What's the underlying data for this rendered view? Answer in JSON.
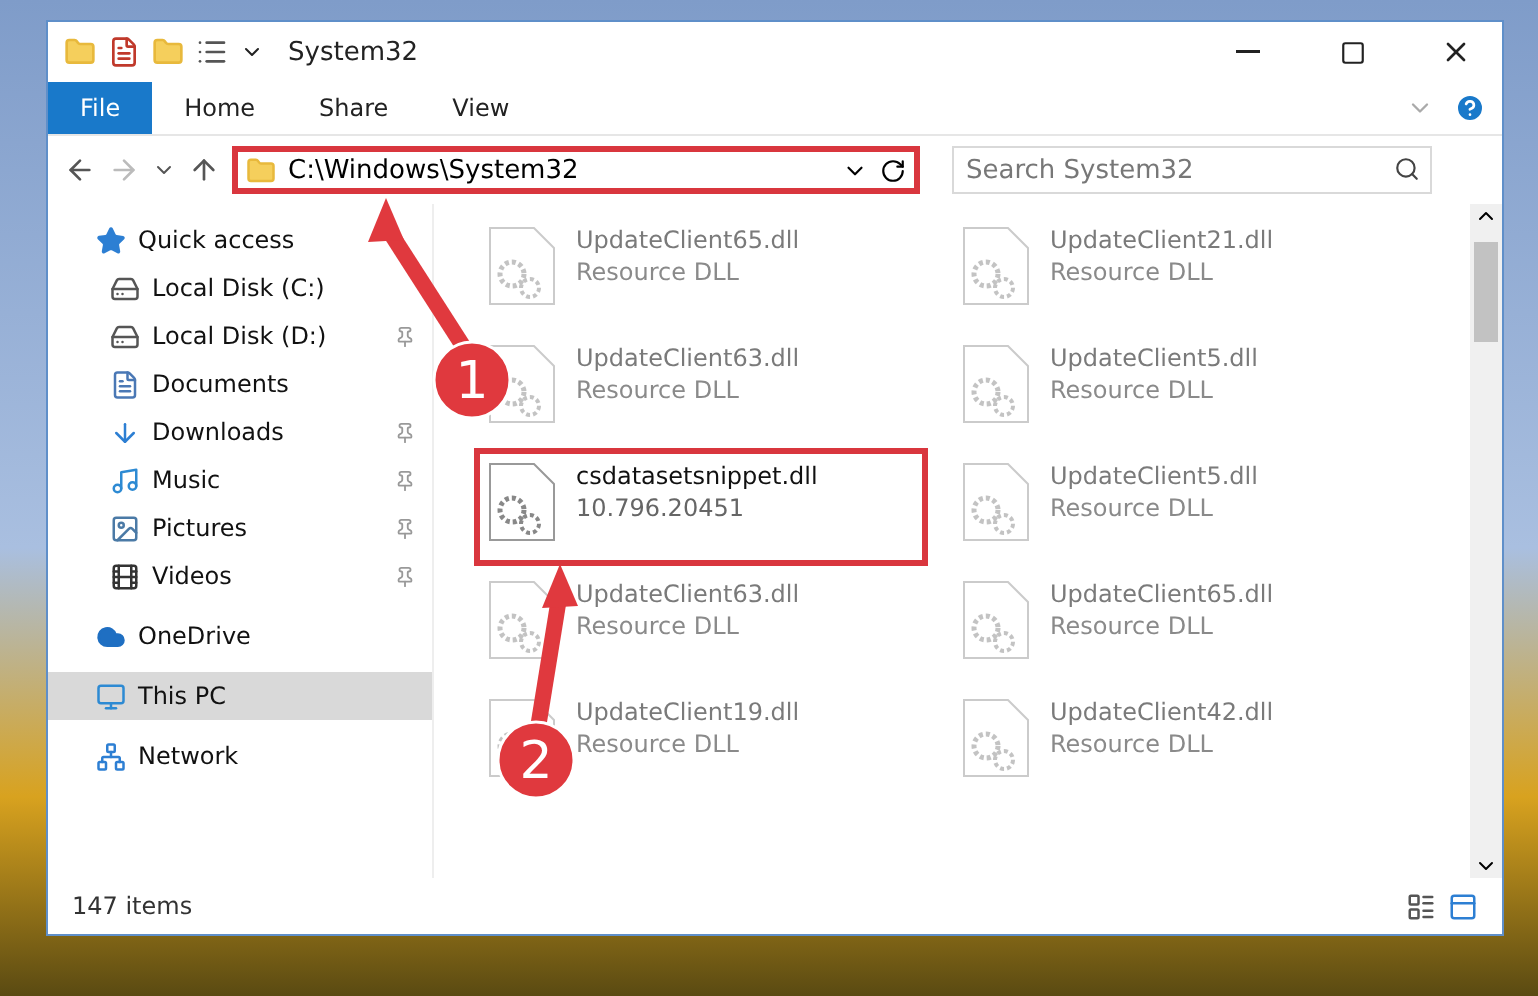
{
  "window": {
    "title": "System32"
  },
  "ribbon": {
    "tabs": [
      {
        "label": "File",
        "selected": true
      },
      {
        "label": "Home",
        "selected": false
      },
      {
        "label": "Share",
        "selected": false
      },
      {
        "label": "View",
        "selected": false
      }
    ]
  },
  "address_bar": {
    "path": "C:\\Windows\\System32",
    "outlined": true
  },
  "search": {
    "placeholder": "Search System32"
  },
  "sidebar": {
    "items": [
      {
        "label": "Quick access",
        "kind": "star",
        "selected": false,
        "children": [
          {
            "label": "Local Disk (C:)",
            "kind": "disk",
            "pinned": false,
            "selected": false
          },
          {
            "label": "Local Disk (D:)",
            "kind": "disk",
            "pinned": true,
            "selected": false
          },
          {
            "label": "Documents",
            "kind": "document",
            "pinned": false,
            "selected": false
          },
          {
            "label": "Downloads",
            "kind": "download",
            "pinned": true,
            "selected": false
          },
          {
            "label": "Music",
            "kind": "music",
            "pinned": true,
            "selected": false
          },
          {
            "label": "Pictures",
            "kind": "picture",
            "pinned": true,
            "selected": false
          },
          {
            "label": "Videos",
            "kind": "video",
            "pinned": true,
            "selected": false
          }
        ]
      },
      {
        "label": "OneDrive",
        "kind": "cloud",
        "selected": false
      },
      {
        "label": "This PC",
        "kind": "pc",
        "selected": true
      },
      {
        "label": "Network",
        "kind": "network",
        "selected": false
      }
    ]
  },
  "files": [
    {
      "name": "UpdateClient65.dll",
      "detail": "Resource DLL",
      "blurred": true,
      "outlined": false
    },
    {
      "name": "UpdateClient21.dll",
      "detail": "Resource DLL",
      "blurred": true,
      "outlined": false
    },
    {
      "name": "UpdateClient63.dll",
      "detail": "Resource DLL",
      "blurred": true,
      "outlined": false
    },
    {
      "name": "UpdateClient5.dll",
      "detail": "Resource DLL",
      "blurred": true,
      "outlined": false
    },
    {
      "name": "csdatasetsnippet.dll",
      "detail": "10.796.20451",
      "blurred": false,
      "outlined": true
    },
    {
      "name": "UpdateClient5.dll",
      "detail": "Resource DLL",
      "blurred": true,
      "outlined": false
    },
    {
      "name": "UpdateClient63.dll",
      "detail": "Resource DLL",
      "blurred": true,
      "outlined": false
    },
    {
      "name": "UpdateClient65.dll",
      "detail": "Resource DLL",
      "blurred": true,
      "outlined": false
    },
    {
      "name": "UpdateClient19.dll",
      "detail": "Resource DLL",
      "blurred": true,
      "outlined": false
    },
    {
      "name": "UpdateClient42.dll",
      "detail": "Resource DLL",
      "blurred": true,
      "outlined": false
    }
  ],
  "status_bar": {
    "count": "147 items"
  },
  "callouts": [
    {
      "label": "1"
    },
    {
      "label": "2"
    }
  ]
}
